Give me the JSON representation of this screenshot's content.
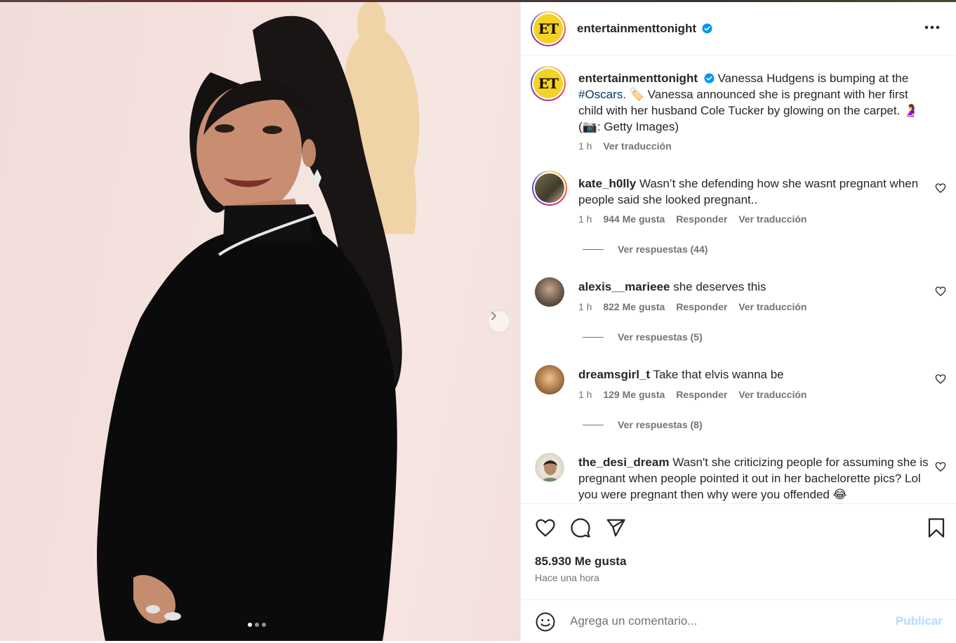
{
  "post": {
    "account": "entertainmenttonight",
    "avatar_text": "ET",
    "verified": true,
    "more_icon": "more-horizontal-icon",
    "carousel": {
      "slide_count": 3,
      "active_index": 0,
      "next_icon": "chevron-right-icon"
    }
  },
  "caption": {
    "username": "entertainmenttonight",
    "text_before": "Vanessa Hudgens is bumping at the",
    "hashtag": "#Oscars",
    "text_after": ". 🏷️ Vanessa announced she is pregnant with her first child with her husband Cole Tucker by glowing on the carpet. 🤰 (📷: Getty Images)",
    "time": "1 h",
    "translate": "Ver traducción"
  },
  "comments": [
    {
      "username": "kate_h0lly",
      "text": "Wasn’t she defending how she wasnt pregnant when people said she looked pregnant..",
      "time": "1 h",
      "likes": "944 Me gusta",
      "reply": "Responder",
      "translate": "Ver traducción",
      "replies": "Ver respuestas (44)"
    },
    {
      "username": "alexis__marieee",
      "text": "she deserves this",
      "time": "1 h",
      "likes": "822 Me gusta",
      "reply": "Responder",
      "translate": "Ver traducción",
      "replies": "Ver respuestas (5)"
    },
    {
      "username": "dreamsgirl_t",
      "text": "Take that elvis wanna be",
      "time": "1 h",
      "likes": "129 Me gusta",
      "reply": "Responder",
      "translate": "Ver traducción",
      "replies": "Ver respuestas (8)"
    },
    {
      "username": "the_desi_dream",
      "text": "Wasn't she criticizing people for assuming she is pregnant when people pointed it out in her bachelorette pics? Lol you were pregnant then why were you offended 😂"
    }
  ],
  "actions": {
    "like_icon": "heart-icon",
    "comment_icon": "comment-icon",
    "share_icon": "send-icon",
    "save_icon": "bookmark-icon",
    "likes_count": "85.930 Me gusta",
    "posted": "Hace una hora"
  },
  "composer": {
    "emoji_icon": "emoji-icon",
    "placeholder": "Agrega un comentario...",
    "submit": "Publicar"
  },
  "colors": {
    "verified": "#0095f6",
    "hashtag": "#00376b",
    "submit_disabled": "#b3dbff"
  }
}
